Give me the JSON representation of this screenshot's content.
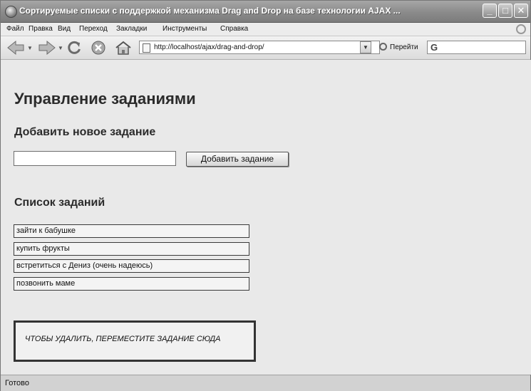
{
  "window": {
    "title": "Сортируемые списки с поддержкой механизма Drag and Drop на базе технологии AJAX ...",
    "controls": {
      "minimize": "_",
      "maximize": "□",
      "close": "✕"
    }
  },
  "menu": {
    "items": [
      "Файл",
      "Правка",
      "Вид",
      "Переход",
      "Закладки",
      "Инструменты",
      "Справка"
    ]
  },
  "toolbar": {
    "url": "http://localhost/ajax/drag-and-drop/",
    "go_label": "Перейти",
    "search_logo": "G",
    "icons": [
      "back-arrow-icon",
      "forward-arrow-icon",
      "reload-icon",
      "stop-icon",
      "home-icon",
      "page-icon",
      "go-icon",
      "google-icon"
    ]
  },
  "page": {
    "title": "Управление заданиями",
    "add_heading": "Добавить новое задание",
    "task_input_value": "",
    "add_button": "Добавить задание",
    "list_heading": "Список заданий",
    "tasks": [
      "зайти к бабушке",
      "купить фрукты",
      "встретиться с Дениз (очень надеюсь)",
      "позвонить маме"
    ],
    "trash_label": "ЧТОБЫ УДАЛИТЬ, ПЕРЕМЕСТИТЕ ЗАДАНИЕ СЮДА"
  },
  "status": {
    "text": "Готово"
  }
}
